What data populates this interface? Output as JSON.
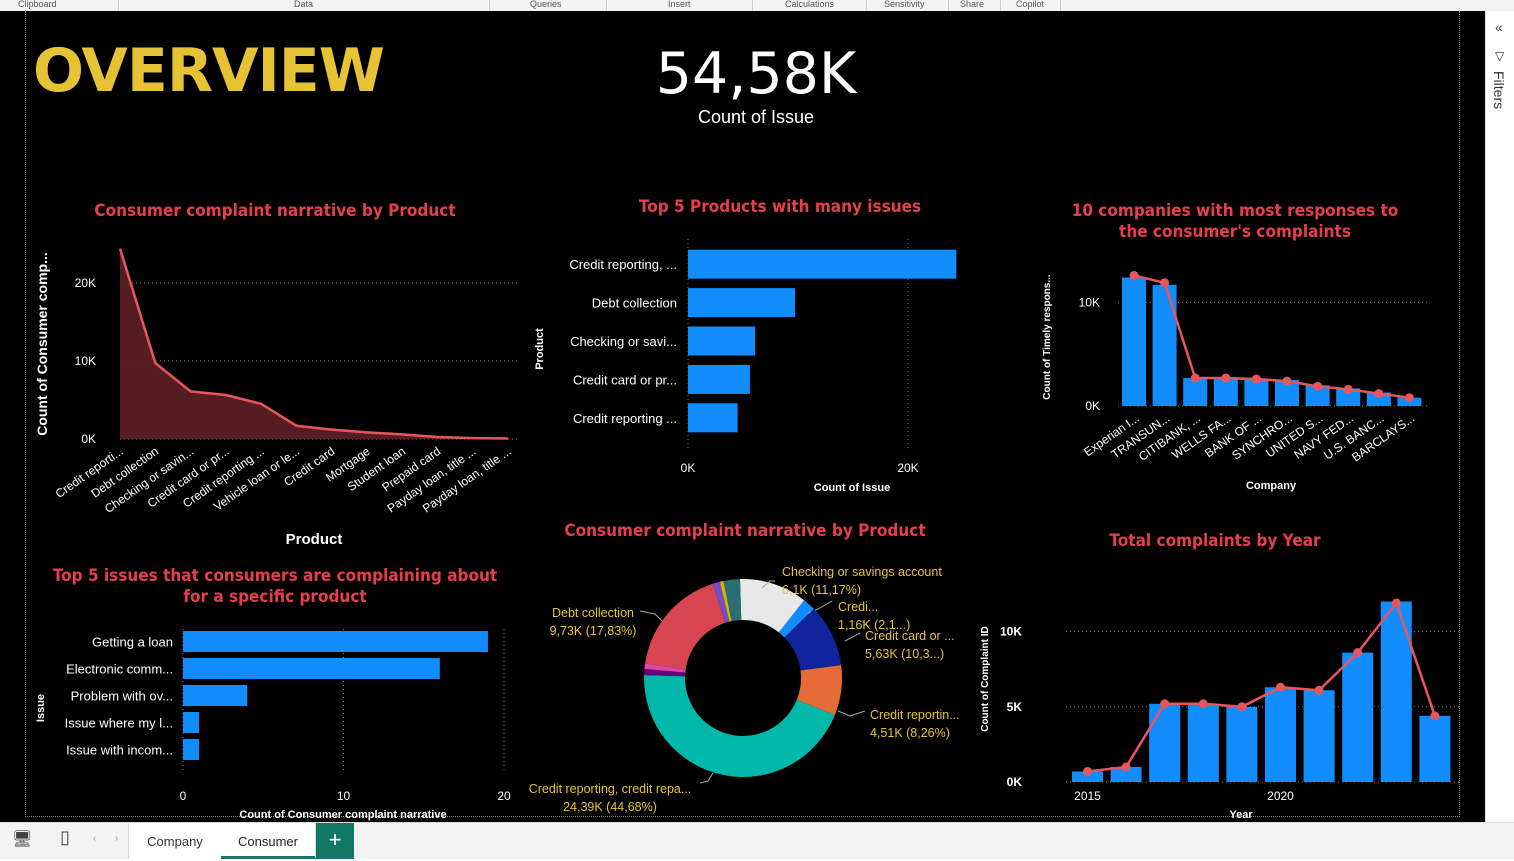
{
  "ribbon": [
    "Clipboard",
    "Data",
    "Queries",
    "Insert",
    "Calculations",
    "Sensitivity",
    "Share",
    "Copilot"
  ],
  "title": "OVERVIEW",
  "kpi": {
    "value": "54,58K",
    "label": "Count of Issue"
  },
  "filters_label": "Filters",
  "tabs": [
    "Company",
    "Consumer"
  ],
  "active_tab": "Consumer",
  "colors": {
    "bar": "#118dff",
    "line": "#e8555e",
    "title": "#e63e4a",
    "overview": "#e5c334",
    "area": "#5a1f23"
  },
  "chart_data": [
    {
      "id": "area-product",
      "type": "area",
      "title": "Consumer complaint narrative by Product",
      "xlabel": "Product",
      "ylabel": "Count of Consumer comp...",
      "yticks": [
        "0K",
        "10K",
        "20K"
      ],
      "ylim": [
        0,
        26000
      ],
      "categories": [
        "Credit reporti...",
        "Debt collection",
        "Checking or savin...",
        "Credit card or pr...",
        "Credit reporting ...",
        "Vehicle loan or le...",
        "Credit card",
        "Mortgage",
        "Student loan",
        "Prepaid card",
        "Payday loan, title ...",
        "Payday loan, title ..."
      ],
      "values": [
        24390,
        9730,
        6100,
        5630,
        4510,
        1700,
        1200,
        850,
        600,
        250,
        120,
        60
      ]
    },
    {
      "id": "bar-top5-products",
      "type": "bar",
      "title": "Top 5 Products with many issues",
      "xlabel": "Count of Issue",
      "ylabel": "Product",
      "xticks": [
        "0K",
        "20K"
      ],
      "xlim": [
        0,
        20000
      ],
      "categories": [
        "Credit reporting, ...",
        "Debt collection",
        "Checking or savi...",
        "Credit card or pr...",
        "Credit reporting ..."
      ],
      "values": [
        24390,
        9730,
        6100,
        5630,
        4510
      ]
    },
    {
      "id": "combo-companies",
      "type": "bar",
      "title": "10 companies with most responses to the consumer's complaints",
      "xlabel": "Company",
      "ylabel": "Count of Timely respons...",
      "yticks": [
        "0K",
        "10K"
      ],
      "ylim": [
        0,
        14000
      ],
      "categories": [
        "Experian I...",
        "TRANSUN...",
        "CITIBANK, ...",
        "WELLS FA...",
        "BANK OF ...",
        "SYNCHRO...",
        "UNITED S...",
        "NAVY FED...",
        "U.S. BANC...",
        "BARCLAYS..."
      ],
      "values": [
        12400,
        11700,
        2700,
        2700,
        2600,
        2500,
        2000,
        1700,
        1300,
        800
      ],
      "line_values": [
        12600,
        11900,
        2700,
        2700,
        2600,
        2400,
        1900,
        1600,
        1200,
        800
      ]
    },
    {
      "id": "bar-top5-issues",
      "type": "bar",
      "title": "Top 5 issues that consumers are complaining about for a specific product",
      "xlabel": "Count of Consumer complaint narrative",
      "ylabel": "Issue",
      "xticks": [
        "0",
        "10",
        "20"
      ],
      "xlim": [
        0,
        20
      ],
      "categories": [
        "Getting a loan",
        "Electronic comm...",
        "Problem with ov...",
        "Issue where my l...",
        "Issue with incom..."
      ],
      "values": [
        19,
        16,
        4,
        1,
        1
      ]
    },
    {
      "id": "donut-product",
      "type": "pie",
      "title": "Consumer complaint narrative by Product",
      "slices": [
        {
          "label": "Checking or savings account",
          "value_text": "6,1K (11,17%)",
          "value": 11.17,
          "color": "#e8e8e8"
        },
        {
          "label": "Credi...",
          "value_text": "1,16K (2,1...)",
          "value": 2.1,
          "color": "#118dff"
        },
        {
          "label": "Credit card or ...",
          "value_text": "5,63K (10,3...)",
          "value": 10.3,
          "color": "#12239e"
        },
        {
          "label": "Credit reportin...",
          "value_text": "4,51K (8,26%)",
          "value": 8.26,
          "color": "#e66c37"
        },
        {
          "label": "Credit reporting, credit repa...",
          "value_text": "24,39K (44,68%)",
          "value": 44.68,
          "color": "#01b8aa"
        },
        {
          "label": "",
          "value_text": "",
          "value": 1.0,
          "color": "#6b007b"
        },
        {
          "label": "",
          "value_text": "",
          "value": 0.9,
          "color": "#e044a7"
        },
        {
          "label": "Debt collection",
          "value_text": "9,73K (17,83%)",
          "value": 17.83,
          "color": "#d64550"
        },
        {
          "label": "",
          "value_text": "",
          "value": 1.2,
          "color": "#744ec2"
        },
        {
          "label": "",
          "value_text": "",
          "value": 0.6,
          "color": "#d9b300"
        },
        {
          "label": "",
          "value_text": "",
          "value": 2.7,
          "color": "#2a6f73"
        }
      ]
    },
    {
      "id": "combo-year",
      "type": "bar",
      "title": "Total complaints by Year",
      "xlabel": "Year",
      "ylabel": "Count of Complaint ID",
      "yticks": [
        "0K",
        "5K",
        "10K"
      ],
      "ylim": [
        0,
        12500
      ],
      "xticks": [
        "2015",
        "2020"
      ],
      "x": [
        2015,
        2016,
        2017,
        2018,
        2019,
        2020,
        2021,
        2022,
        2023,
        2024
      ],
      "values": [
        700,
        1000,
        5200,
        5200,
        5000,
        6300,
        6100,
        8600,
        12000,
        4400
      ],
      "line_values": [
        700,
        1000,
        5200,
        5200,
        5000,
        6300,
        6100,
        8600,
        11900,
        4400
      ]
    }
  ]
}
